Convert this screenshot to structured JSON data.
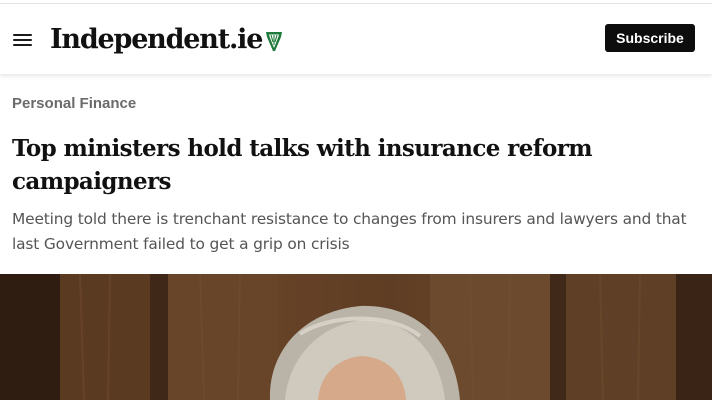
{
  "header": {
    "logo_text": "Independent.ie",
    "subscribe_label": "Subscribe",
    "logo_icon": "harp-icon",
    "menu_icon": "hamburger-menu-icon",
    "colors": {
      "logo_harp": "#1e7b3c",
      "subscribe_bg": "#0d0d0d"
    }
  },
  "article": {
    "section": "Personal Finance",
    "headline": "Top ministers hold talks with insurance reform campaigners",
    "standfirst": "Meeting told there is trenchant resistance to changes from insurers and lawyers and that last Government failed to get a grip on crisis"
  }
}
